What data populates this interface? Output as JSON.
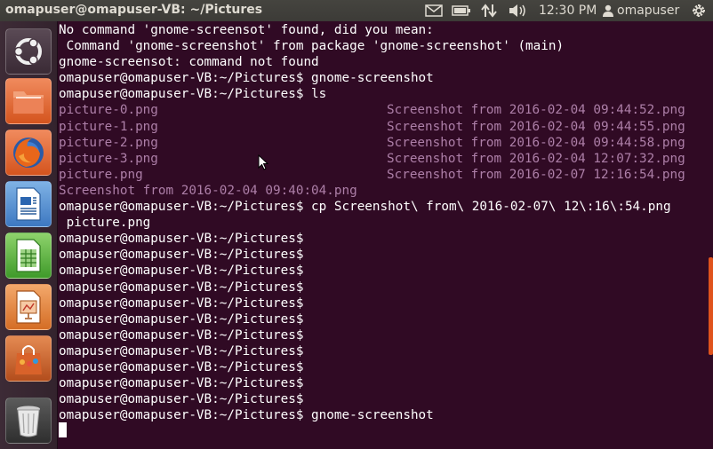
{
  "window": {
    "title": "omapuser@omapuser-VB: ~/Pictures"
  },
  "panel": {
    "clock": "12:30 PM",
    "user": "omapuser",
    "tray_icons": [
      "mail-icon",
      "battery-icon",
      "network-icon",
      "volume-icon",
      "user-icon",
      "gear-icon"
    ]
  },
  "launcher": {
    "items": [
      "ubuntu-dash",
      "files",
      "firefox",
      "libreoffice-writer",
      "libreoffice-calc",
      "libreoffice-impress",
      "software-center",
      "trash"
    ]
  },
  "terminal": {
    "lines": [
      "No command 'gnome-screensot' found, did you mean:",
      " Command 'gnome-screenshot' from package 'gnome-screenshot' (main)",
      "gnome-screensot: command not found",
      "omapuser@omapuser-VB:~/Pictures$ gnome-screenshot",
      "omapuser@omapuser-VB:~/Pictures$ ls"
    ],
    "ls_files": [
      {
        "left": "picture-0.png",
        "right": "Screenshot from 2016-02-04 09:44:52.png"
      },
      {
        "left": "picture-1.png",
        "right": "Screenshot from 2016-02-04 09:44:55.png"
      },
      {
        "left": "picture-2.png",
        "right": "Screenshot from 2016-02-04 09:44:58.png"
      },
      {
        "left": "picture-3.png",
        "right": "Screenshot from 2016-02-04 12:07:32.png"
      },
      {
        "left": "picture.png",
        "right": "Screenshot from 2016-02-07 12:16:54.png"
      }
    ],
    "ls_last": "Screenshot from 2016-02-04 09:40:04.png",
    "after_lines": [
      "omapuser@omapuser-VB:~/Pictures$ cp Screenshot\\ from\\ 2016-02-07\\ 12\\:16\\:54.png",
      " picture.png",
      "omapuser@omapuser-VB:~/Pictures$",
      "omapuser@omapuser-VB:~/Pictures$",
      "omapuser@omapuser-VB:~/Pictures$",
      "omapuser@omapuser-VB:~/Pictures$",
      "omapuser@omapuser-VB:~/Pictures$",
      "omapuser@omapuser-VB:~/Pictures$",
      "omapuser@omapuser-VB:~/Pictures$",
      "omapuser@omapuser-VB:~/Pictures$",
      "omapuser@omapuser-VB:~/Pictures$",
      "omapuser@omapuser-VB:~/Pictures$",
      "omapuser@omapuser-VB:~/Pictures$",
      "omapuser@omapuser-VB:~/Pictures$ gnome-screenshot"
    ]
  },
  "colors": {
    "terminal_bg": "#300a24",
    "terminal_fg": "#ffffff",
    "ls_file_color": "#ad7fa8",
    "panel_bg": "#3c3b37"
  }
}
